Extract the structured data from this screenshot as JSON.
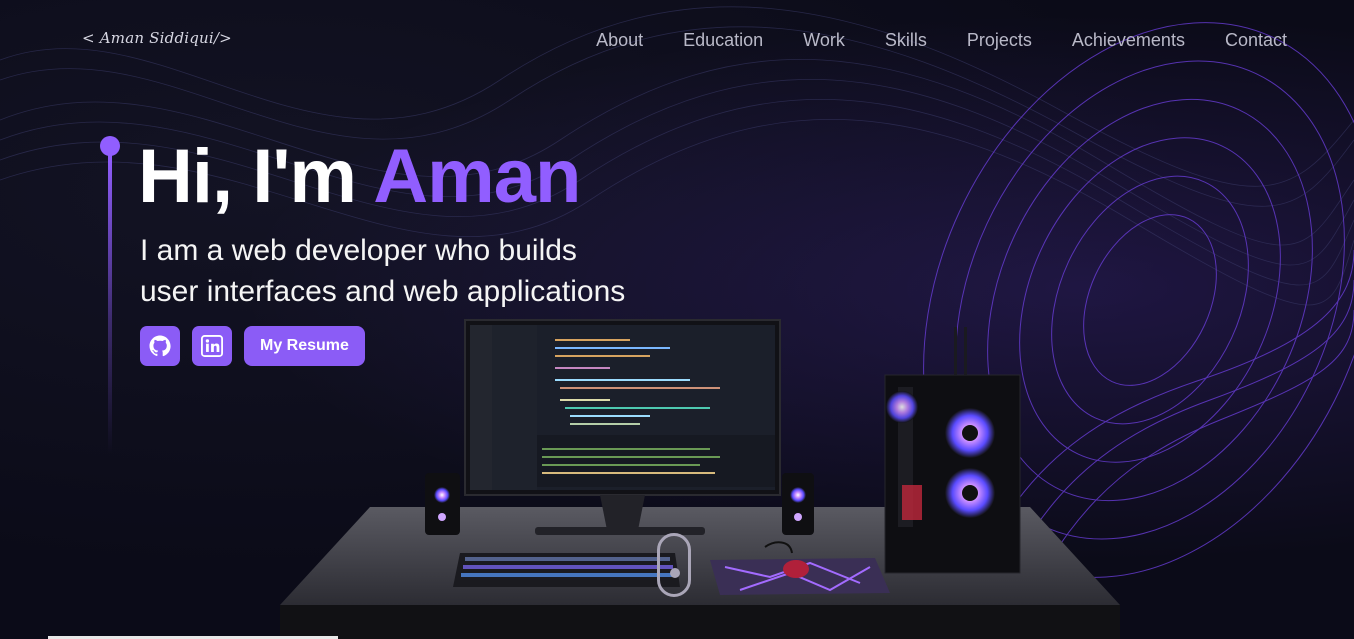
{
  "logo": "< Aman Siddiqui/>",
  "nav": {
    "items": [
      "About",
      "Education",
      "Work",
      "Skills",
      "Projects",
      "Achievements",
      "Contact"
    ]
  },
  "hero": {
    "greeting": "Hi, I'm ",
    "name": "Aman",
    "subtitle_line1": "I am a web developer who builds",
    "subtitle_line2": "user interfaces and web applications",
    "resume_label": "My Resume"
  },
  "icons": {
    "github": "github-icon",
    "linkedin": "linkedin-icon"
  },
  "colors": {
    "accent": "#915eff",
    "button": "#8b5cf6",
    "background": "#0b0b18"
  }
}
